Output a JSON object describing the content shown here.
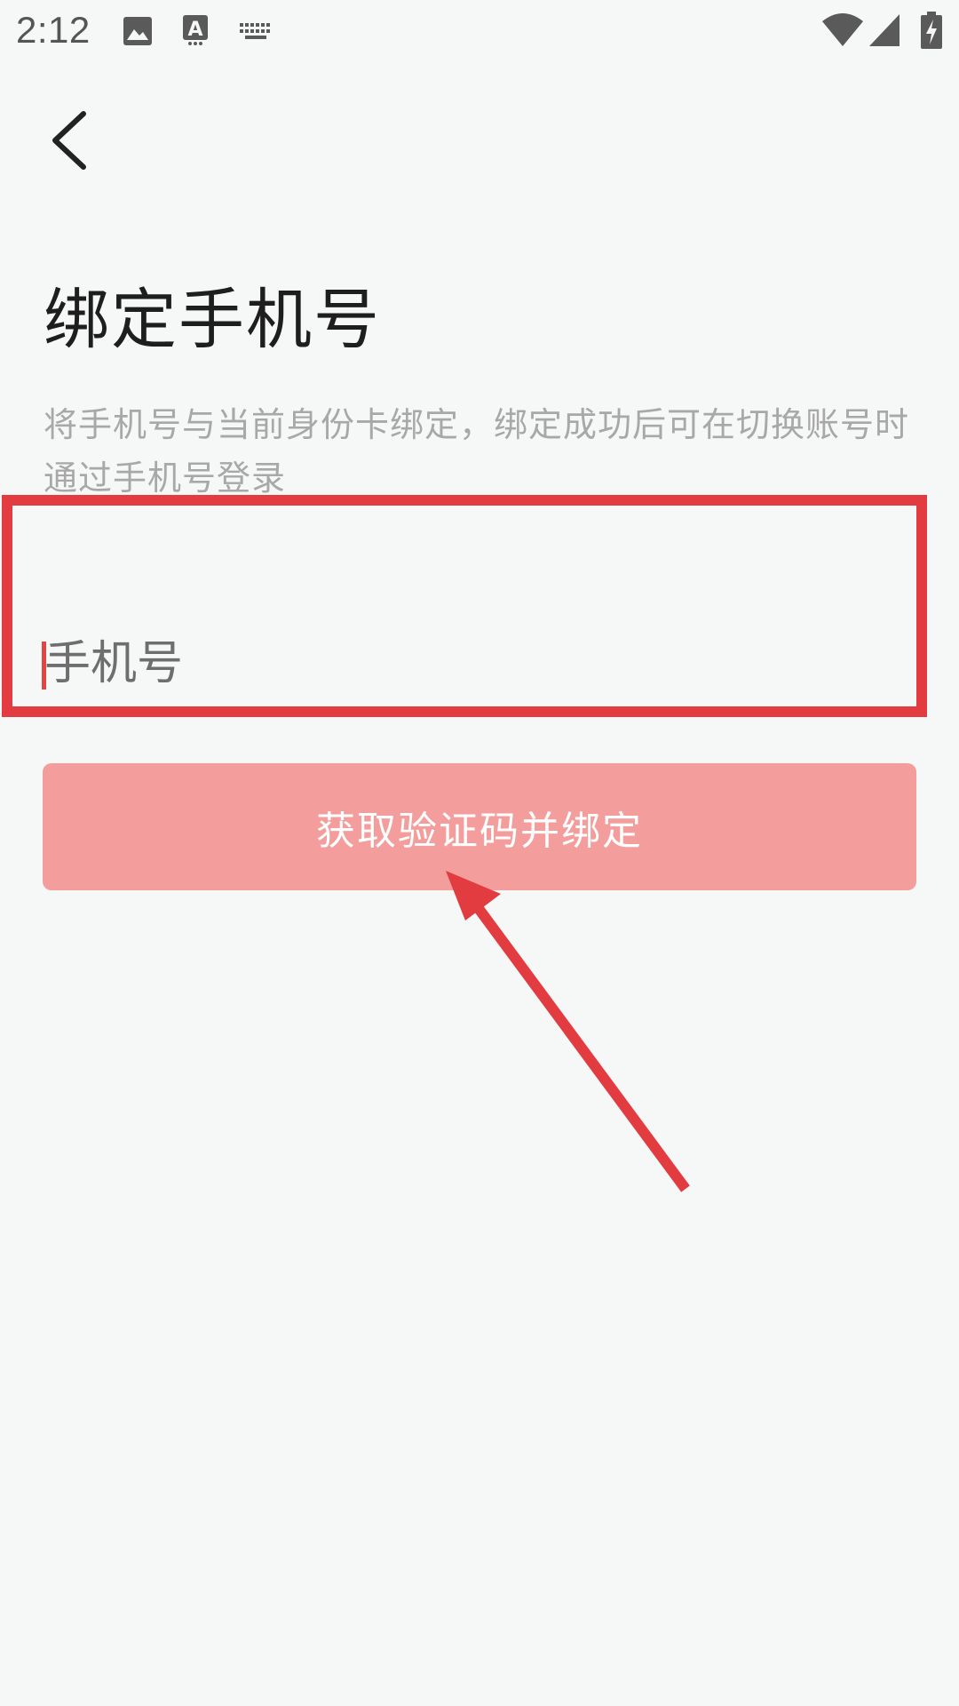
{
  "status_bar": {
    "time": "2:12",
    "left_icons": [
      "image-icon",
      "text-input-icon",
      "keyboard-icon"
    ],
    "right_icons": [
      "wifi-icon",
      "cell-signal-icon",
      "battery-charging-icon"
    ]
  },
  "header": {
    "back_icon": "chevron-left-icon"
  },
  "main": {
    "title": "绑定手机号",
    "description": "将手机号与当前身份卡绑定，绑定成功后可在切换账号时通过手机号登录",
    "phone_input": {
      "value": "",
      "placeholder": "手机号"
    },
    "submit_label": "获取验证码并绑定"
  },
  "annotation": {
    "highlight_color": "#e23c41"
  },
  "colors": {
    "background": "#f6f7f7",
    "button": "#f39e9c",
    "accent": "#e34545",
    "title": "#1e1e1e",
    "description": "#a8a8a8"
  }
}
